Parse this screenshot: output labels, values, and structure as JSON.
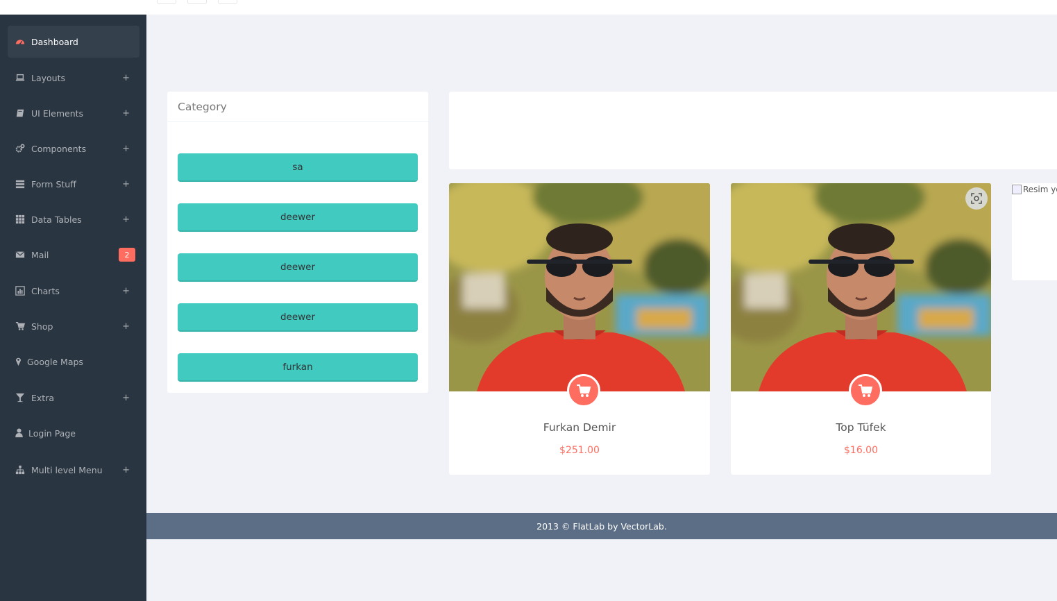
{
  "colors": {
    "sidebar_bg": "#2a3542",
    "accent_teal": "#41cac0",
    "accent_red": "#ff6c60",
    "footer_bg": "#5c6e85",
    "page_bg": "#f1f2f7"
  },
  "sidebar": {
    "items": [
      {
        "label": "Dashboard",
        "icon": "dashboard-icon",
        "active": true
      },
      {
        "label": "Layouts",
        "icon": "laptop-icon",
        "expand": "+"
      },
      {
        "label": "UI Elements",
        "icon": "book-icon",
        "expand": "+"
      },
      {
        "label": "Components",
        "icon": "cogs-icon",
        "expand": "+"
      },
      {
        "label": "Form Stuff",
        "icon": "tasks-icon",
        "expand": "+"
      },
      {
        "label": "Data Tables",
        "icon": "grid-icon",
        "expand": "+"
      },
      {
        "label": "Mail",
        "icon": "envelope-icon",
        "badge": "2"
      },
      {
        "label": "Charts",
        "icon": "bar-chart-icon",
        "expand": "+"
      },
      {
        "label": "Shop",
        "icon": "shopping-cart-icon",
        "expand": "+"
      },
      {
        "label": "Google Maps",
        "icon": "map-marker-icon"
      },
      {
        "label": "Extra",
        "icon": "glass-icon",
        "expand": "+"
      },
      {
        "label": "Login Page",
        "icon": "user-icon"
      },
      {
        "label": "Multi level Menu",
        "icon": "sitemap-icon",
        "expand": "+"
      }
    ]
  },
  "category": {
    "title": "Category",
    "buttons": [
      "sa",
      "deewer",
      "deewer",
      "deewer",
      "furkan"
    ]
  },
  "products": [
    {
      "name": "Furkan Demir",
      "price": "$251.00"
    },
    {
      "name": "Top Tüfek",
      "price": "$16.00"
    }
  ],
  "broken_image_alt": "Resim yo",
  "footer": {
    "text": "2013 © FlatLab by VectorLab."
  }
}
